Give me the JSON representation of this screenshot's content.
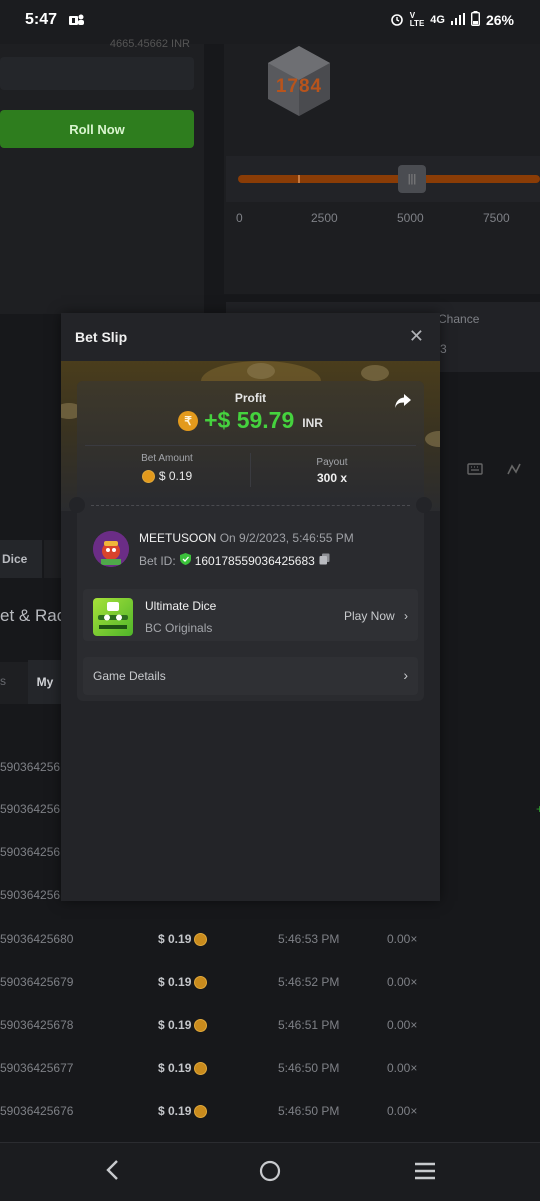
{
  "status_bar": {
    "time": "5:47",
    "network": "4G",
    "battery": "26%"
  },
  "background": {
    "roll_button": "Roll Now",
    "top_value": "4665.45662 INR",
    "cube_value": "1784",
    "slider_scale": [
      "0",
      "2500",
      "5000",
      "7500"
    ],
    "chance_label": "Chance",
    "chance_value": "3",
    "dice_tab": "Dice",
    "section_title": "et & Rac",
    "tab_partial": "s",
    "tab_my": "My",
    "rows_partial": [
      {
        "id": "590364256"
      },
      {
        "id": "590364256"
      },
      {
        "id": "590364256"
      },
      {
        "id": "590364256"
      },
      {
        "id": "59036425680",
        "amount": "$ 0.19",
        "time": "5:46:53 PM",
        "mult": "0.00×"
      },
      {
        "id": "59036425679",
        "amount": "$ 0.19",
        "time": "5:46:52 PM",
        "mult": "0.00×"
      },
      {
        "id": "59036425678",
        "amount": "$ 0.19",
        "time": "5:46:51 PM",
        "mult": "0.00×"
      },
      {
        "id": "59036425677",
        "amount": "$ 0.19",
        "time": "5:46:50 PM",
        "mult": "0.00×"
      },
      {
        "id": "59036425676",
        "amount": "$ 0.19",
        "time": "5:46:50 PM",
        "mult": "0.00×"
      }
    ]
  },
  "modal": {
    "title": "Bet Slip",
    "profit_label": "Profit",
    "profit_value": "+$ 59.79",
    "profit_currency": "INR",
    "currency_symbol": "₹",
    "bet_amount_label": "Bet Amount",
    "bet_amount_value": "$ 0.19",
    "payout_label": "Payout",
    "payout_value": "300 x",
    "username": "MEETUSOON",
    "date_text": "On 9/2/2023, 5:46:55 PM",
    "bet_id_label": "Bet ID:",
    "bet_id": "160178559036425683",
    "game_name": "Ultimate Dice",
    "game_provider": "BC Originals",
    "play_now": "Play Now",
    "game_details": "Game Details"
  },
  "colors": {
    "profit": "#45d23e",
    "accent_orange": "#e39a1c",
    "roll_green": "#2e7d1e"
  }
}
